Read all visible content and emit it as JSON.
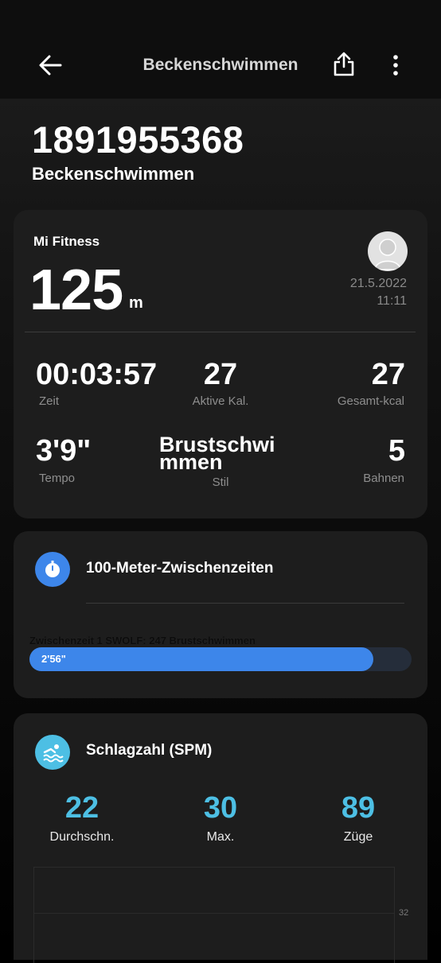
{
  "header": {
    "title": "Beckenschwimmen",
    "icons": [
      "back-arrow-icon",
      "share-icon",
      "more-vert-icon"
    ]
  },
  "hero": {
    "number": "1891955368",
    "subtitle": "Beckenschwimmen"
  },
  "summary": {
    "source": "Mi Fitness",
    "distance_value": "125",
    "distance_unit": "m",
    "date": "21.5.2022",
    "time": "11:11",
    "stats": [
      {
        "value": "00:03:57",
        "label": "Zeit"
      },
      {
        "value": "27",
        "label": "Aktive Kal."
      },
      {
        "value": "27",
        "label": "Gesamt-kcal"
      },
      {
        "value": "3'9\"",
        "label": "Tempo"
      },
      {
        "value": "Brustschwi mmen",
        "label": "Stil"
      },
      {
        "value": "5",
        "label": "Bahnen"
      }
    ]
  },
  "splits": {
    "title": "100-Meter-Zwischenzeiten",
    "icon": "stopwatch-icon",
    "items": [
      {
        "caption": "Zwischenzeit 1  SWOLF: 247  Brustschwimmen",
        "time": "2'56\"",
        "progress": 0.9
      }
    ]
  },
  "stroke_rate": {
    "title": "Schlagzahl (SPM)",
    "icon": "swimming-icon",
    "stats": [
      {
        "value": "22",
        "label": "Durchschn."
      },
      {
        "value": "30",
        "label": "Max."
      },
      {
        "value": "89",
        "label": "Züge"
      }
    ],
    "axis_label": "32"
  },
  "colors": {
    "accent_blue": "#3d86ea",
    "stat_cyan": "#4dbfe4",
    "card_bg": "#1d1d1d"
  }
}
